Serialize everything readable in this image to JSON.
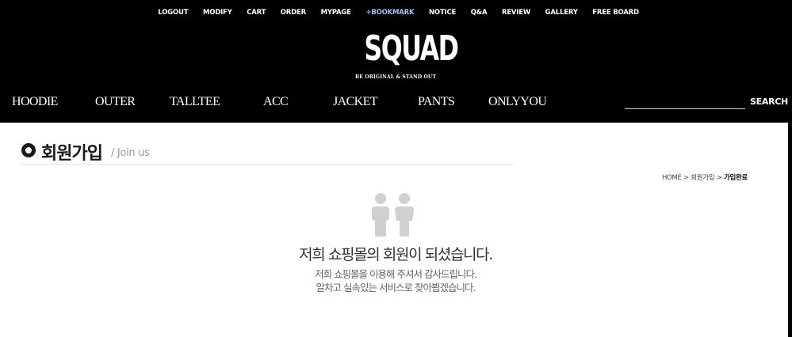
{
  "top_links": [
    "LOGOUT",
    "MODIFY",
    "CART",
    "ORDER",
    "MYPAGE",
    "+BOOKMARK",
    "NOTICE",
    "Q&A",
    "REVIEW",
    "GALLERY",
    "FREE BOARD"
  ],
  "logo": {
    "main": "SQUAD",
    "tagline": "BE ORIGINAL & STAND OUT"
  },
  "main_nav": [
    "HOODIE",
    "OUTER",
    "TALLTEE",
    "ACC",
    "JACKET",
    "PANTS",
    "ONLYYOU"
  ],
  "search": {
    "button_label": "SEARCH",
    "value": ""
  },
  "page": {
    "title": "회원가입",
    "subtitle": "/ Join us"
  },
  "breadcrumb": {
    "home": "HOME",
    "sep1": " > ",
    "middle": "회원가입",
    "sep2": " > ",
    "current": "가입완료"
  },
  "message": {
    "headline": "저희 쇼핑몰의 회원이 되셨습니다.",
    "line1": "저희 쇼핑몰을 이용해 주셔서 감사드립니다.",
    "line2": "알차고 실속있는 서비스로 찾아뵙겠습니다."
  },
  "colors": {
    "header_bg": "#000000",
    "bookmark_accent": "#9fc3f5",
    "icon_gray": "#d0d0d0"
  },
  "icons": {
    "title_bullet": "ring-bullet-icon",
    "members": "people-icon"
  }
}
